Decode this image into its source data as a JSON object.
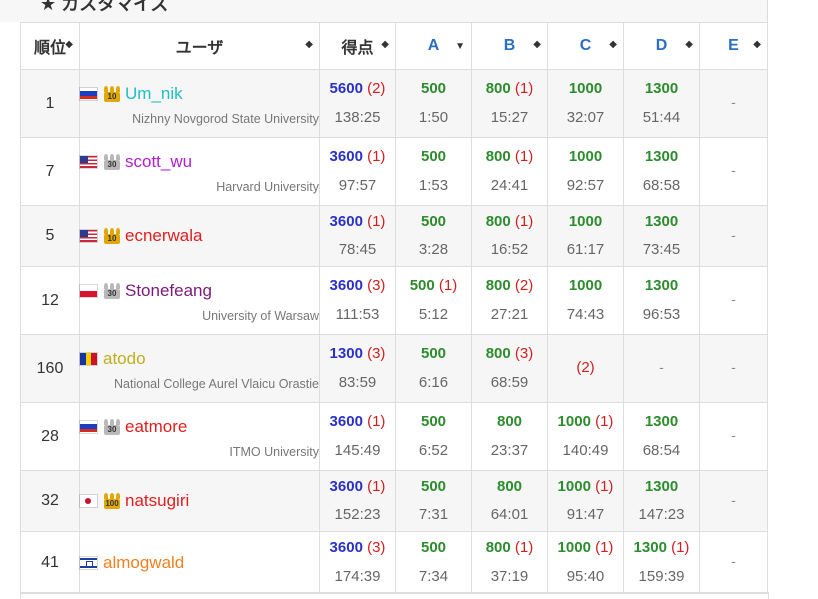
{
  "section_title": "★ カスタマイズ",
  "columns": {
    "rank": "順位",
    "user": "ユーザ",
    "score": "得点",
    "tasks": [
      "A",
      "B",
      "C",
      "D",
      "E"
    ]
  },
  "rows": [
    {
      "rank": "1",
      "flag": "ru",
      "crown": "10",
      "crown_color": "#e0a800",
      "name": "Um_nik",
      "name_color": "#20c0c0",
      "affiliation": "Nizhny Novgorod State University",
      "total": {
        "points": "5600",
        "pen": "(2)",
        "time": "138:25"
      },
      "tasks": [
        {
          "points": "500",
          "pen": "",
          "time": "1:50"
        },
        {
          "points": "800",
          "pen": "(1)",
          "time": "15:27"
        },
        {
          "points": "1000",
          "pen": "",
          "time": "32:07"
        },
        {
          "points": "1300",
          "pen": "",
          "time": "51:44"
        },
        {
          "dash": "-"
        }
      ]
    },
    {
      "rank": "7",
      "flag": "us",
      "crown": "30",
      "crown_color": "#b8b8b8",
      "name": "scott_wu",
      "name_color": "#b020d0",
      "affiliation": "Harvard University",
      "total": {
        "points": "3600",
        "pen": "(1)",
        "time": "97:57"
      },
      "tasks": [
        {
          "points": "500",
          "pen": "",
          "time": "1:53"
        },
        {
          "points": "800",
          "pen": "(1)",
          "time": "24:41"
        },
        {
          "points": "1000",
          "pen": "",
          "time": "92:57"
        },
        {
          "points": "1300",
          "pen": "",
          "time": "68:58"
        },
        {
          "dash": "-"
        }
      ]
    },
    {
      "rank": "5",
      "flag": "us",
      "crown": "10",
      "crown_color": "#e0a800",
      "name": "ecnerwala",
      "name_color": "#e02020",
      "affiliation": "",
      "total": {
        "points": "3600",
        "pen": "(1)",
        "time": "78:45"
      },
      "tasks": [
        {
          "points": "500",
          "pen": "",
          "time": "3:28"
        },
        {
          "points": "800",
          "pen": "(1)",
          "time": "16:52"
        },
        {
          "points": "1000",
          "pen": "",
          "time": "61:17"
        },
        {
          "points": "1300",
          "pen": "",
          "time": "73:45"
        },
        {
          "dash": "-"
        }
      ]
    },
    {
      "rank": "12",
      "flag": "pl",
      "crown": "30",
      "crown_color": "#b8b8b8",
      "name": "Stonefeang",
      "name_color": "#7a1a7a",
      "affiliation": "University of Warsaw",
      "total": {
        "points": "3600",
        "pen": "(3)",
        "time": "111:53"
      },
      "tasks": [
        {
          "points": "500",
          "pen": "(1)",
          "time": "5:12"
        },
        {
          "points": "800",
          "pen": "(2)",
          "time": "27:21"
        },
        {
          "points": "1000",
          "pen": "",
          "time": "74:43"
        },
        {
          "points": "1300",
          "pen": "",
          "time": "96:53"
        },
        {
          "dash": "-"
        }
      ]
    },
    {
      "rank": "160",
      "flag": "ro",
      "crown": "",
      "crown_color": "",
      "name": "atodo",
      "name_color": "#c0b020",
      "affiliation": "National College Aurel Vlaicu Orastie",
      "total": {
        "points": "1300",
        "pen": "(3)",
        "time": "83:59"
      },
      "tasks": [
        {
          "points": "500",
          "pen": "",
          "time": "6:16"
        },
        {
          "points": "800",
          "pen": "(3)",
          "time": "68:59"
        },
        {
          "points": "",
          "pen": "(2)",
          "time": ""
        },
        {
          "dash": "-"
        },
        {
          "dash": "-"
        }
      ]
    },
    {
      "rank": "28",
      "flag": "ru",
      "crown": "30",
      "crown_color": "#b8b8b8",
      "name": "eatmore",
      "name_color": "#e02020",
      "affiliation": "ITMO University",
      "total": {
        "points": "3600",
        "pen": "(1)",
        "time": "145:49"
      },
      "tasks": [
        {
          "points": "500",
          "pen": "",
          "time": "6:52"
        },
        {
          "points": "800",
          "pen": "",
          "time": "23:37"
        },
        {
          "points": "1000",
          "pen": "(1)",
          "time": "140:49"
        },
        {
          "points": "1300",
          "pen": "",
          "time": "68:54"
        },
        {
          "dash": "-"
        }
      ]
    },
    {
      "rank": "32",
      "flag": "jp",
      "crown": "100",
      "crown_color": "#e0a800",
      "name": "natsugiri",
      "name_color": "#e02020",
      "affiliation": "",
      "total": {
        "points": "3600",
        "pen": "(1)",
        "time": "152:23"
      },
      "tasks": [
        {
          "points": "500",
          "pen": "",
          "time": "7:31"
        },
        {
          "points": "800",
          "pen": "",
          "time": "64:01"
        },
        {
          "points": "1000",
          "pen": "(1)",
          "time": "91:47"
        },
        {
          "points": "1300",
          "pen": "",
          "time": "147:23"
        },
        {
          "dash": "-"
        }
      ]
    },
    {
      "rank": "41",
      "flag": "il",
      "crown": "",
      "crown_color": "",
      "name": "almogwald",
      "name_color": "#f08020",
      "affiliation": "",
      "total": {
        "points": "3600",
        "pen": "(3)",
        "time": "174:39"
      },
      "tasks": [
        {
          "points": "500",
          "pen": "",
          "time": "7:34"
        },
        {
          "points": "800",
          "pen": "(1)",
          "time": "37:19"
        },
        {
          "points": "1000",
          "pen": "(1)",
          "time": "95:40"
        },
        {
          "points": "1300",
          "pen": "(1)",
          "time": "159:39"
        },
        {
          "dash": "-"
        }
      ]
    }
  ]
}
